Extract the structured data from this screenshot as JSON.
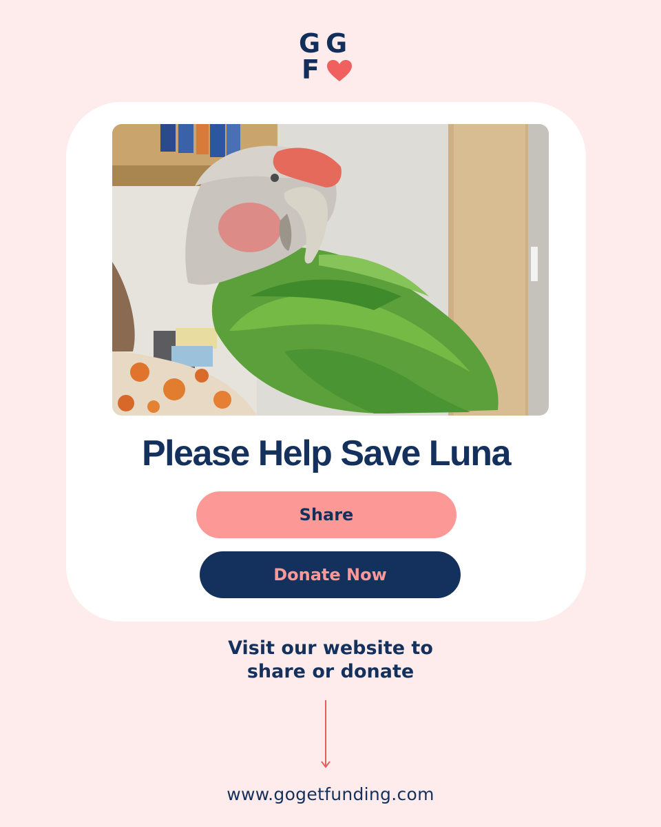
{
  "logo": {
    "letters": [
      "G",
      "G",
      "F"
    ],
    "heart_icon": "heart-icon",
    "navy": "#122e5a",
    "coral": "#f0605e"
  },
  "campaign": {
    "headline": "Please Help Save Luna",
    "photo_icon": "parrot-photo"
  },
  "buttons": {
    "share_label": "Share",
    "donate_label": "Donate Now"
  },
  "cta": {
    "line1": "Visit our website to",
    "line2": "share or donate",
    "arrow_icon": "arrow-down-icon"
  },
  "footer": {
    "website": "www.gogetfunding.com"
  },
  "colors": {
    "background": "#fdeceb",
    "navy": "#14305c",
    "coral": "#fc9996",
    "card": "#ffffff"
  }
}
